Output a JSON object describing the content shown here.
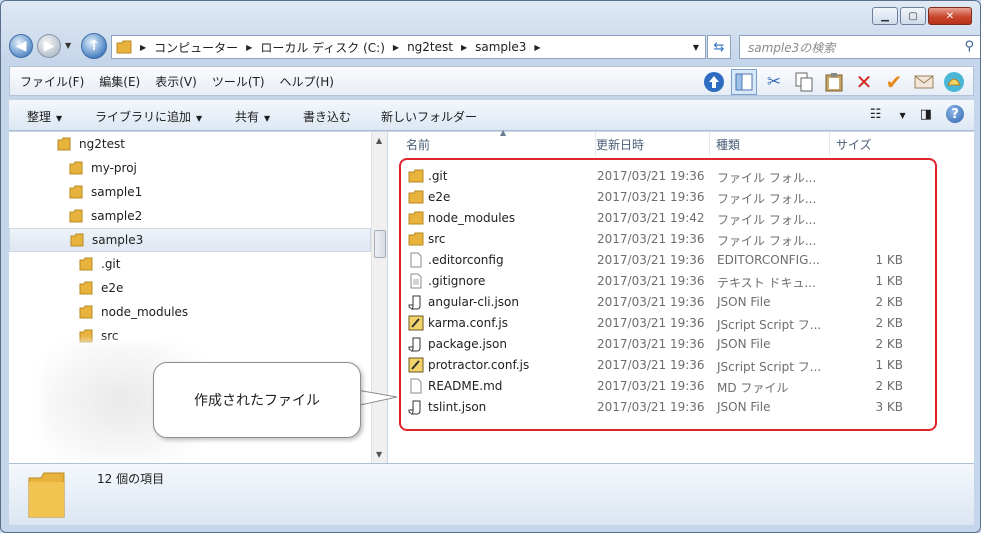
{
  "window": {
    "caption_buttons": [
      "minimize",
      "maximize",
      "close"
    ]
  },
  "address_bar": {
    "crumbs": [
      "コンピューター",
      "ローカル ディスク (C:)",
      "ng2test",
      "sample3"
    ],
    "search_placeholder": "sample3の検索"
  },
  "menu": {
    "items": [
      "ファイル(F)",
      "編集(E)",
      "表示(V)",
      "ツール(T)",
      "ヘルプ(H)"
    ]
  },
  "command_bar": {
    "organize": "整理",
    "add_to_library": "ライブラリに追加",
    "share": "共有",
    "burn": "書き込む",
    "new_folder": "新しいフォルダー"
  },
  "nav_tree": {
    "items": [
      {
        "label": "ng2test"
      },
      {
        "label": "my-proj"
      },
      {
        "label": "sample1"
      },
      {
        "label": "sample2"
      },
      {
        "label": "sample3",
        "selected": true
      },
      {
        "label": ".git"
      },
      {
        "label": "e2e"
      },
      {
        "label": "node_modules"
      },
      {
        "label": "src"
      }
    ]
  },
  "file_list": {
    "columns": [
      "名前",
      "更新日時",
      "種類",
      "サイズ"
    ],
    "rows": [
      {
        "name": ".git",
        "date": "2017/03/21 19:36",
        "type": "ファイル フォル...",
        "size": "",
        "icon": "folder-icon"
      },
      {
        "name": "e2e",
        "date": "2017/03/21 19:36",
        "type": "ファイル フォル...",
        "size": "",
        "icon": "folder-icon"
      },
      {
        "name": "node_modules",
        "date": "2017/03/21 19:42",
        "type": "ファイル フォル...",
        "size": "",
        "icon": "folder-icon"
      },
      {
        "name": "src",
        "date": "2017/03/21 19:36",
        "type": "ファイル フォル...",
        "size": "",
        "icon": "folder-icon"
      },
      {
        "name": ".editorconfig",
        "date": "2017/03/21 19:36",
        "type": "EDITORCONFIG...",
        "size": "1 KB",
        "icon": "file-icon"
      },
      {
        "name": ".gitignore",
        "date": "2017/03/21 19:36",
        "type": "テキスト ドキュ...",
        "size": "1 KB",
        "icon": "text-file-icon"
      },
      {
        "name": "angular-cli.json",
        "date": "2017/03/21 19:36",
        "type": "JSON File",
        "size": "2 KB",
        "icon": "json-file-icon"
      },
      {
        "name": "karma.conf.js",
        "date": "2017/03/21 19:36",
        "type": "JScript Script フ...",
        "size": "2 KB",
        "icon": "script-file-icon"
      },
      {
        "name": "package.json",
        "date": "2017/03/21 19:36",
        "type": "JSON File",
        "size": "2 KB",
        "icon": "json-file-icon"
      },
      {
        "name": "protractor.conf.js",
        "date": "2017/03/21 19:36",
        "type": "JScript Script フ...",
        "size": "1 KB",
        "icon": "script-file-icon"
      },
      {
        "name": "README.md",
        "date": "2017/03/21 19:36",
        "type": "MD ファイル",
        "size": "2 KB",
        "icon": "file-icon"
      },
      {
        "name": "tslint.json",
        "date": "2017/03/21 19:36",
        "type": "JSON File",
        "size": "3 KB",
        "icon": "json-file-icon"
      }
    ]
  },
  "callout": {
    "text": "作成されたファイル"
  },
  "details_pane": {
    "item_count": "12 個の項目"
  },
  "colors": {
    "highlight_border": "#e0242c",
    "folder": "#e8b33c"
  }
}
